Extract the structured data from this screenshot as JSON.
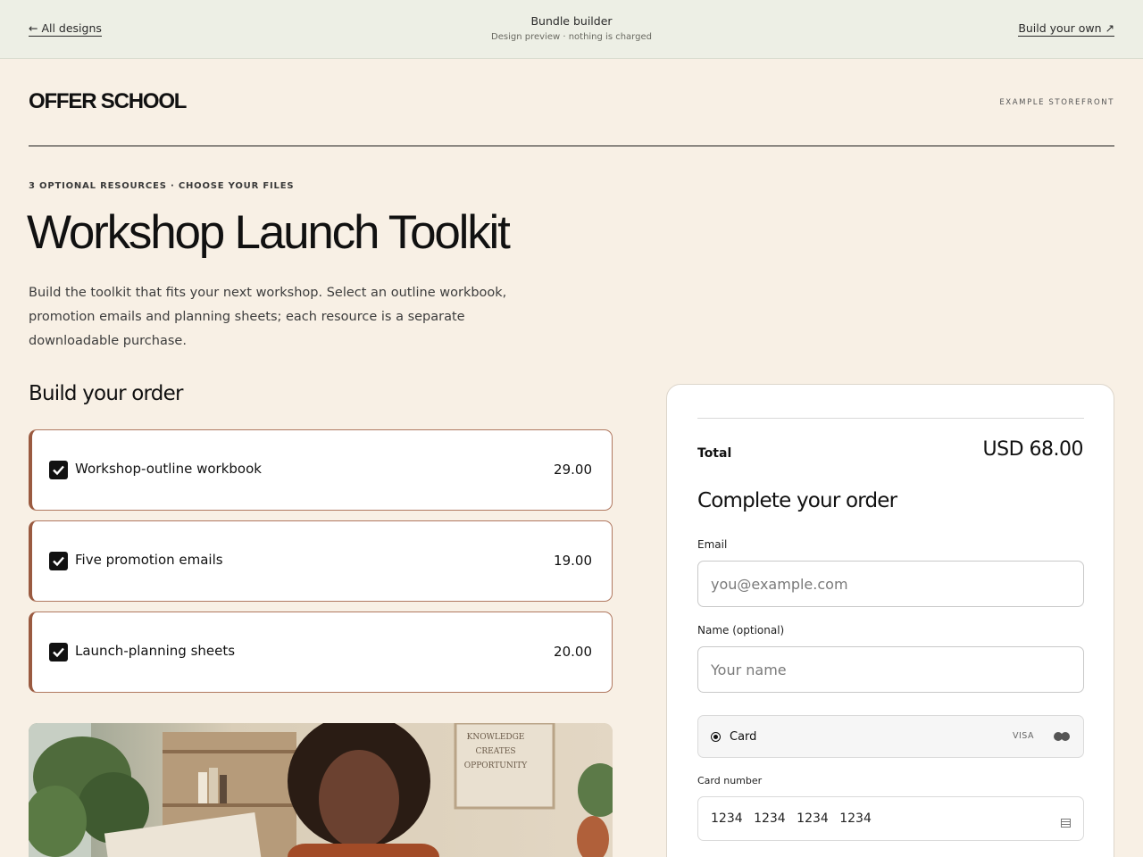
{
  "topbar": {
    "back_link": "← All designs",
    "title": "Bundle builder",
    "subtitle": "Design preview · nothing is charged",
    "build_link": "Build your own ↗"
  },
  "header": {
    "brand": "OFFER SCHOOL",
    "storefront_label": "EXAMPLE STOREFRONT"
  },
  "hero": {
    "eyebrow": "3 OPTIONAL RESOURCES · CHOOSE YOUR FILES",
    "title": "Workshop Launch Toolkit",
    "description": "Build the toolkit that fits your next workshop. Select an outline workbook, promotion emails and planning sheets; each resource is a separate downloadable purchase."
  },
  "order": {
    "heading": "Build your order",
    "items": [
      {
        "name": "Workshop-outline workbook",
        "price": "29.00",
        "checked": true
      },
      {
        "name": "Five promotion emails",
        "price": "19.00",
        "checked": true
      },
      {
        "name": "Launch-planning sheets",
        "price": "20.00",
        "checked": true
      }
    ]
  },
  "photo": {
    "poster_lines": [
      "KNOWLEDGE",
      "CREATES",
      "OPPORTUNITY"
    ]
  },
  "checkout": {
    "total_label": "Total",
    "total_value": "USD 68.00",
    "heading": "Complete your order",
    "email_label": "Email",
    "email_placeholder": "you@example.com",
    "name_label": "Name (optional)",
    "name_placeholder": "Your name",
    "payment_method": "Card",
    "visa_label": "VISA",
    "card_number_label": "Card number",
    "card_number_value": "1234 1234 1234 1234"
  },
  "colors": {
    "page_bg": "#f8f0e5",
    "topbar_bg": "#edefe5",
    "item_border": "#9a5a40"
  }
}
